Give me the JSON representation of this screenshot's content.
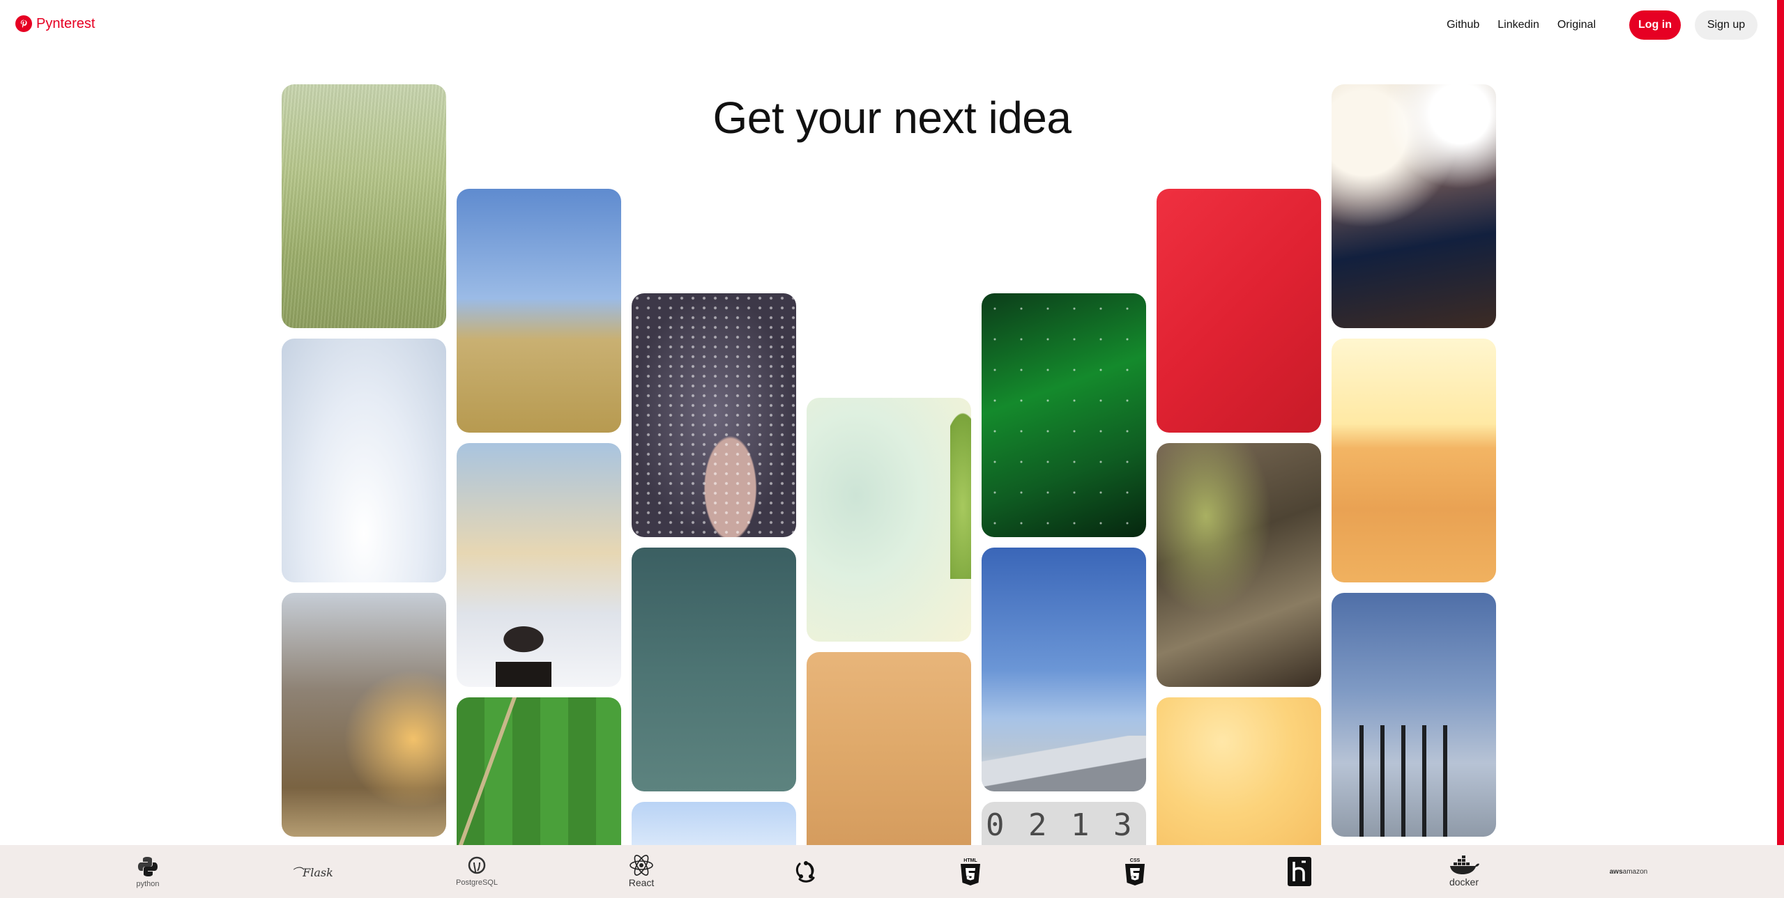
{
  "header": {
    "logo_text": "Pynterest",
    "logo_icon": "pinterest-p-icon",
    "nav": [
      {
        "label": "Github"
      },
      {
        "label": "Linkedin"
      },
      {
        "label": "Original"
      }
    ],
    "login_label": "Log in",
    "signup_label": "Sign up",
    "brand_color": "#e60023"
  },
  "hero": {
    "title": "Get your next idea"
  },
  "pins": [
    {
      "subject": "grass-field"
    },
    {
      "subject": "snowy-blur"
    },
    {
      "subject": "spark-bokeh"
    },
    {
      "subject": "sneaker-field"
    },
    {
      "subject": "man-above-clouds"
    },
    {
      "subject": "golf-course"
    },
    {
      "subject": "hand-on-wet-glass"
    },
    {
      "subject": "teal-water"
    },
    {
      "subject": "light-sky"
    },
    {
      "subject": "branch-blur"
    },
    {
      "subject": "desert-sky"
    },
    {
      "subject": "green-aurora"
    },
    {
      "subject": "snowy-mountain"
    },
    {
      "subject": "number-dials"
    },
    {
      "subject": "red-wall"
    },
    {
      "subject": "mossy-log"
    },
    {
      "subject": "yellow-glow"
    },
    {
      "subject": "bokeh-lights"
    },
    {
      "subject": "sunset-city"
    },
    {
      "subject": "pier-posts"
    }
  ],
  "footer": {
    "technologies": [
      {
        "icon": "python-icon",
        "label": "python"
      },
      {
        "icon": "flask-icon",
        "label": "Flask"
      },
      {
        "icon": "postgresql-icon",
        "label": "PostgreSQL"
      },
      {
        "icon": "react-icon",
        "label": "React"
      },
      {
        "icon": "redux-icon",
        "label": ""
      },
      {
        "icon": "html5-icon",
        "label": "HTML"
      },
      {
        "icon": "css3-icon",
        "label": "CSS"
      },
      {
        "icon": "heroku-icon",
        "label": ""
      },
      {
        "icon": "docker-icon",
        "label": "docker"
      },
      {
        "icon": "amazon-web-services-icon",
        "label": "amazon"
      }
    ]
  }
}
